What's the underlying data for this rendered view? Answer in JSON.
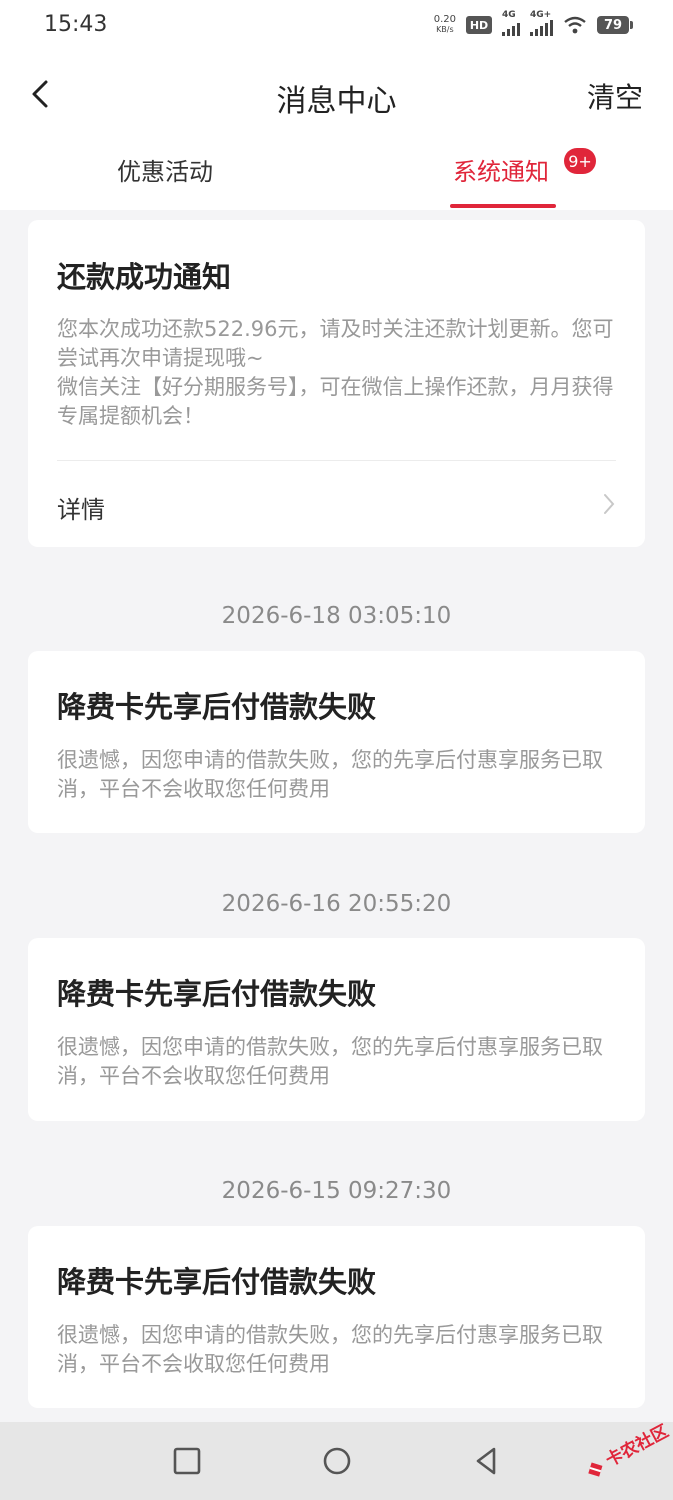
{
  "status_bar": {
    "time": "15:43",
    "net_speed_value": "0.20",
    "net_speed_unit": "KB/s",
    "hd_label": "HD",
    "signal1_label": "4G",
    "signal2_label": "4G+",
    "battery": "79"
  },
  "header": {
    "title": "消息中心",
    "clear_label": "清空"
  },
  "tabs": [
    {
      "label": "优惠活动",
      "active": false
    },
    {
      "label": "系统通知",
      "active": true,
      "badge": "9+"
    }
  ],
  "messages": [
    {
      "title": "还款成功通知",
      "body": "您本次成功还款522.96元，请及时关注还款计划更新。您可尝试再次申请提现哦~\n微信关注【好分期服务号】，可在微信上操作还款，月月获得专属提额机会！",
      "detail_label": "详情"
    },
    {
      "timestamp": "2026-6-18 03:05:10",
      "title": "降费卡先享后付借款失败",
      "body": "很遗憾，因您申请的借款失败，您的先享后付惠享服务已取消，平台不会收取您任何费用"
    },
    {
      "timestamp": "2026-6-16 20:55:20",
      "title": "降费卡先享后付借款失败",
      "body": "很遗憾，因您申请的借款失败，您的先享后付惠享服务已取消，平台不会收取您任何费用"
    },
    {
      "timestamp": "2026-6-15 09:27:30",
      "title": "降费卡先享后付借款失败",
      "body": "很遗憾，因您申请的借款失败，您的先享后付惠享服务已取消，平台不会收取您任何费用"
    }
  ],
  "watermark_text": "卡农社区",
  "colors": {
    "accent": "#e0263a",
    "background": "#f4f4f6",
    "muted_text": "#999999"
  },
  "icons": {
    "back": "chevron-left-icon",
    "detail": "chevron-right-icon",
    "nav_square": "square-icon",
    "nav_circle": "circle-icon",
    "nav_back": "triangle-back-icon"
  }
}
